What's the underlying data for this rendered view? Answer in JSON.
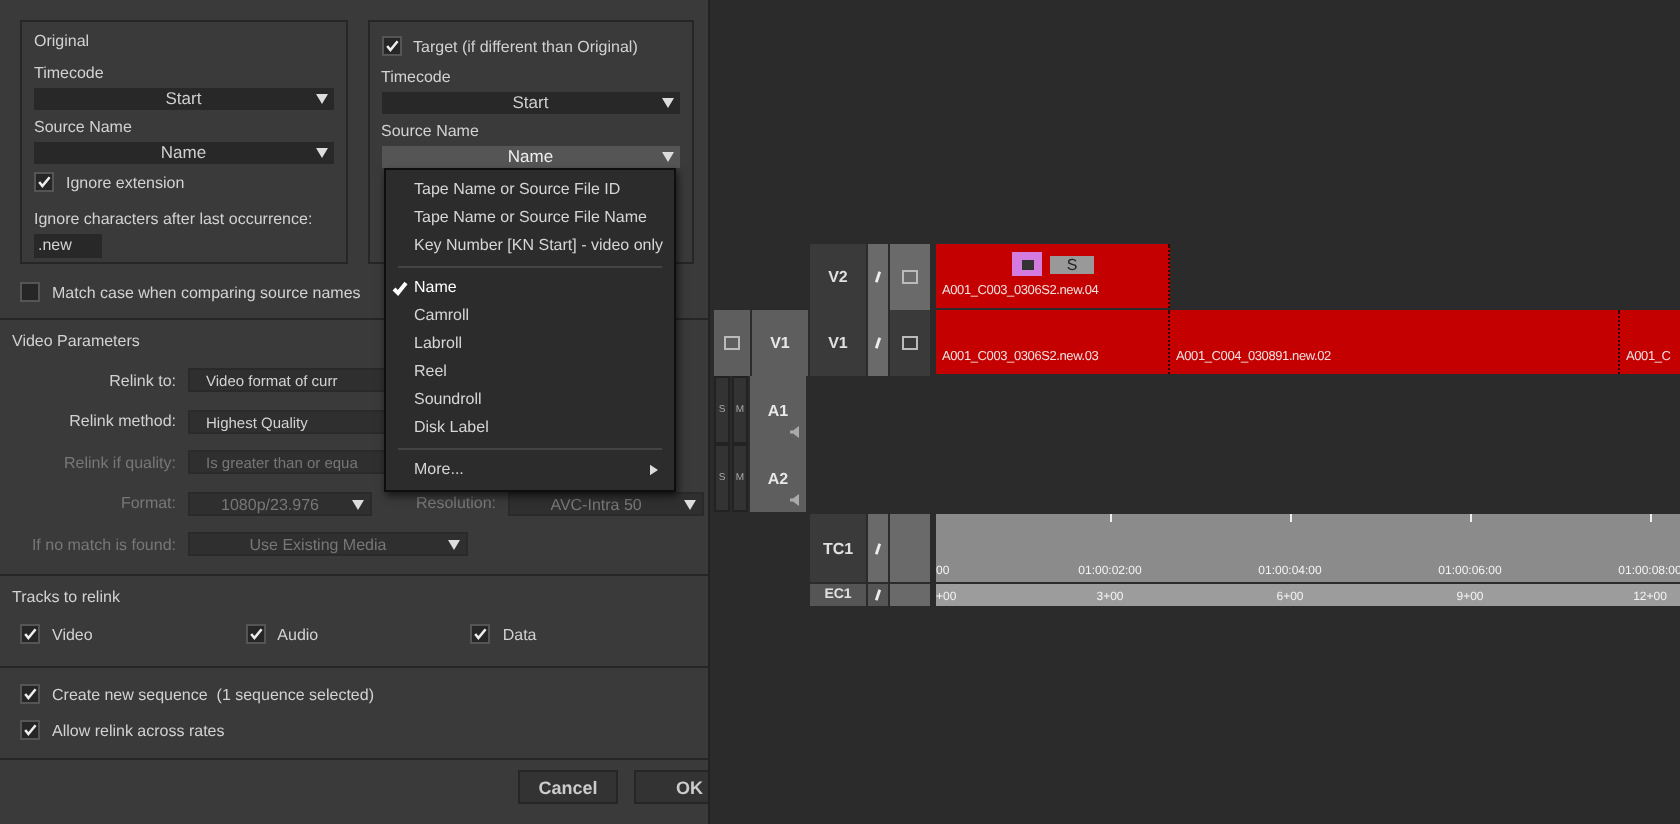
{
  "original": {
    "title": "Original",
    "timecode_label": "Timecode",
    "timecode": "Start",
    "source_name_label": "Source Name",
    "source_name": "Name",
    "ignore_extension": {
      "label": "Ignore extension",
      "checked": true
    },
    "ignore_chars_label": "Ignore characters after last occurrence:",
    "ignore_chars": ".new"
  },
  "target": {
    "label": "Target (if different than Original)",
    "checked": true,
    "timecode_label": "Timecode",
    "timecode": "Start",
    "source_name_label": "Source Name",
    "source_name": "Name"
  },
  "match_case": {
    "label": "Match case when comparing source names",
    "checked": false
  },
  "source_name_menu": {
    "sections": [
      {
        "items": [
          {
            "label": "Tape Name or Source File ID",
            "kind": "item",
            "selected": false
          },
          {
            "label": "Tape Name or Source File Name",
            "kind": "item",
            "selected": false
          },
          {
            "label": "Key Number [KN Start] - video only",
            "kind": "item",
            "selected": false
          }
        ]
      },
      {
        "items": [
          {
            "label": "Name",
            "kind": "item",
            "selected": true
          },
          {
            "label": "Camroll",
            "kind": "item",
            "selected": false
          },
          {
            "label": "Labroll",
            "kind": "item",
            "selected": false
          },
          {
            "label": "Reel",
            "kind": "item",
            "selected": false
          },
          {
            "label": "Soundroll",
            "kind": "item",
            "selected": false
          },
          {
            "label": "Disk Label",
            "kind": "item",
            "selected": false
          }
        ]
      },
      {
        "items": [
          {
            "label": "More...",
            "kind": "submenu",
            "selected": false
          }
        ]
      }
    ]
  },
  "video_parameters": {
    "title": "Video Parameters",
    "rows": [
      {
        "fields": [
          {
            "label": "Relink to:",
            "value": "Video format of curr",
            "disabled": false
          }
        ]
      },
      {
        "fields": [
          {
            "label": "Relink method:",
            "value": "Highest Quality",
            "disabled": false
          }
        ]
      },
      {
        "fields": [
          {
            "label": "Relink if quality:",
            "value": "Is greater than or equa",
            "disabled": true
          }
        ]
      },
      {
        "fields": [
          {
            "label": "Format:",
            "value": "1080p/23.976",
            "disabled": true
          },
          {
            "label": "Resolution:",
            "value": "AVC-Intra 50",
            "disabled": true
          }
        ]
      },
      {
        "fields": [
          {
            "label": "If no match is found:",
            "value": "Use Existing Media",
            "disabled": true
          }
        ]
      }
    ]
  },
  "tracks_to_relink": {
    "title": "Tracks to relink",
    "options": [
      {
        "label": "Video",
        "checked": true
      },
      {
        "label": "Audio",
        "checked": true
      },
      {
        "label": "Data",
        "checked": true
      }
    ]
  },
  "options": [
    {
      "label": "Create new sequence  (1 sequence selected)",
      "checked": true
    },
    {
      "label": "Allow relink across rates",
      "checked": true
    }
  ],
  "buttons": [
    "Cancel",
    "OK"
  ],
  "timeline": {
    "tracks": [
      {
        "kind": "video",
        "name": "V2",
        "clips": [
          {
            "label": "A001_C003_0306S2.new.04",
            "badge": "S"
          }
        ]
      },
      {
        "kind": "video",
        "source": "V1",
        "name": "V1",
        "clips": [
          {
            "label": "A001_C003_0306S2.new.03"
          },
          {
            "label": "A001_C004_030891.new.02"
          },
          {
            "label": "A001_C"
          }
        ]
      },
      {
        "kind": "audio",
        "solo": "S",
        "mute": "M",
        "name": "A1"
      },
      {
        "kind": "audio",
        "solo": "S",
        "mute": "M",
        "name": "A2"
      }
    ],
    "ruler": {
      "tc_label": "TC1",
      "ec_label": "EC1",
      "timecodes": [
        "00",
        "01:00:02:00",
        "01:00:04:00",
        "01:00:06:00",
        "01:00:08:00"
      ],
      "edgecodes": [
        "+00",
        "3+00",
        "6+00",
        "9+00",
        "12+00"
      ]
    }
  }
}
